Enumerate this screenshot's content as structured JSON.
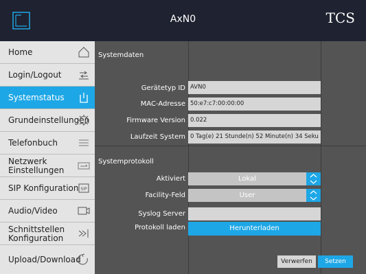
{
  "header": {
    "title": "AxN0",
    "brand": "TCS"
  },
  "sidebar": {
    "items": [
      {
        "label": "Home",
        "icon": "home-icon"
      },
      {
        "label": "Login/Logout",
        "icon": "login-logout-icon"
      },
      {
        "label": "Systemstatus",
        "icon": "status-icon",
        "active": true
      },
      {
        "label": "Grundeinstellungen",
        "icon": "gear-icon"
      },
      {
        "label": "Telefonbuch",
        "icon": "list-icon"
      },
      {
        "label": "Netzwerk Einstellungen",
        "icon": "network-icon"
      },
      {
        "label": "SIP Konfiguration",
        "icon": "sip-icon"
      },
      {
        "label": "Audio/Video",
        "icon": "camera-icon"
      },
      {
        "label": "Schnittstellen Konfiguration",
        "icon": "interface-icon"
      },
      {
        "label": "Upload/Download",
        "icon": "upload-download-icon"
      }
    ]
  },
  "systemdaten": {
    "title": "Systemdaten",
    "rows": [
      {
        "label": "Gerätetyp ID",
        "value": "AVN0"
      },
      {
        "label": "MAC-Adresse",
        "value": "50:e7:c7:00:00:00"
      },
      {
        "label": "Firmware Version",
        "value": "0.022"
      },
      {
        "label": "Laufzeit System",
        "value": "0 Tag(e) 21 Stunde(n) 52 Minute(n) 34 Seku"
      }
    ]
  },
  "systemprotokoll": {
    "title": "Systemprotokoll",
    "aktiviert_label": "Aktiviert",
    "aktiviert_value": "Lokal",
    "facility_label": "Facility-Feld",
    "facility_value": "User",
    "syslog_label": "Syslog Server",
    "syslog_value": "",
    "protokoll_label": "Protokoll laden",
    "download_label": "Herunterladen"
  },
  "footer": {
    "discard_label": "Verwerfen",
    "apply_label": "Setzen"
  },
  "colors": {
    "accent": "#1ea7e6",
    "header_bg": "#1f2230",
    "panel_bg": "#545454",
    "sidebar_bg": "#e4e4e4"
  }
}
